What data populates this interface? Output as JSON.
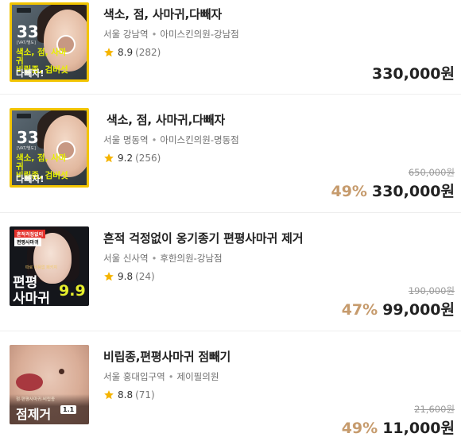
{
  "items": [
    {
      "title": "색소, 점, 사마귀,다빼자",
      "station": "서울 강남역",
      "clinic": "아미스킨의원-강남점",
      "score": "8.9",
      "review_count": "(282)",
      "original_price": "",
      "discount": "",
      "price": "330,000원",
      "thumb": {
        "num": "33",
        "num_sub": "[VAT/별도]",
        "line1": "색소, 점, 사마귀",
        "line2": "비립종, 검버섯",
        "line3": "다빼자!"
      }
    },
    {
      "title": "색소, 점, 사마귀,다빼자",
      "station": "서울 명동역",
      "clinic": "아미스킨의원-명동점",
      "score": "9.2",
      "review_count": "(256)",
      "original_price": "650,000원",
      "discount": "49%",
      "price": "330,000원",
      "thumb": {
        "num": "33",
        "num_sub": "[VAT/별도]",
        "line1": "색소, 점, 사마귀",
        "line2": "비립종, 검버섯",
        "line3": "다빼자!"
      }
    },
    {
      "title": "흔적 걱정없이 옹기종기 편평사마귀 제거",
      "station": "서울 신사역",
      "clinic": "후한의원-강남점",
      "score": "9.8",
      "review_count": "(24)",
      "original_price": "190,000원",
      "discount": "47%",
      "price": "99,000원",
      "thumb": {
        "badge1": "흔적걱정없이",
        "badge2": "편평사마귀",
        "small": "따로 비용없 패키지",
        "big1": "편평",
        "big2": "사마귀",
        "num": "9.9"
      }
    },
    {
      "title": "비립종,편평사마귀 점빼기",
      "station": "서울 홍대입구역",
      "clinic": "제이필의원",
      "score": "8.8",
      "review_count": "(71)",
      "original_price": "21,600원",
      "discount": "49%",
      "price": "11,000원",
      "thumb": {
        "small": "점·편평사마귀·비립종",
        "big": "점제거",
        "tag": "1.1"
      }
    }
  ],
  "colors": {
    "discount": "#c69b6d",
    "star": "#f5b400",
    "thumb_border": "#f2c400"
  },
  "icons": {
    "rating": "star-icon"
  }
}
